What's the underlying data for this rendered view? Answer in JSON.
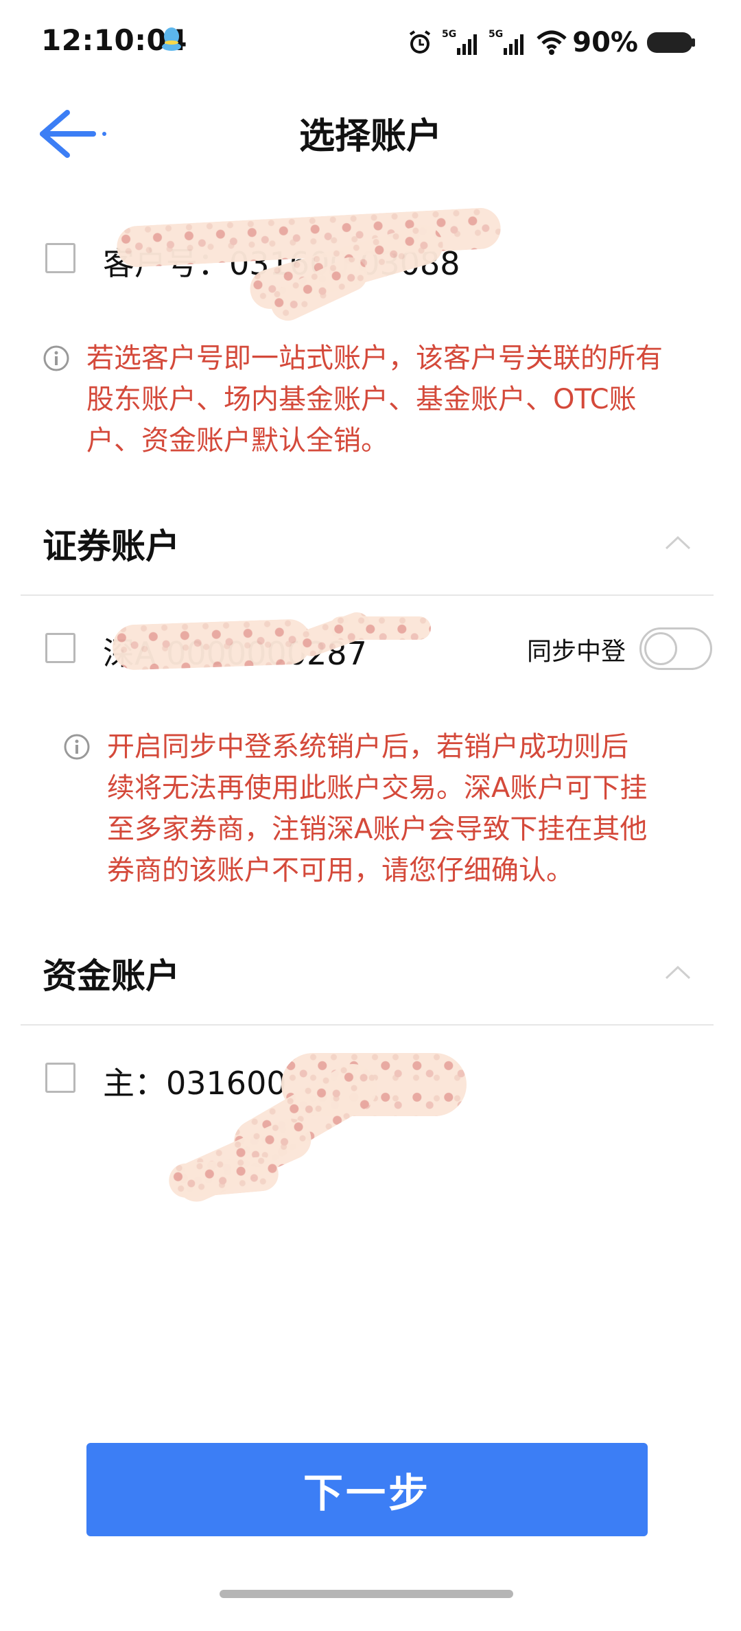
{
  "status_bar": {
    "time": "12:10:04",
    "battery": "90%",
    "icons": [
      "qq-icon",
      "alarm-icon",
      "signal-5g-icon",
      "signal-5g-icon",
      "wifi-icon",
      "battery-icon"
    ]
  },
  "header": {
    "title": "选择账户",
    "back_icon": "arrow-left-icon"
  },
  "customer_account": {
    "label": "客户号：031600 03088"
  },
  "customer_note": {
    "icon": "info-icon",
    "lines": [
      "若选客户号即一站式账户，该客户号关联的所有",
      "股东账户、场内基金账户、基金账户、OTC账",
      "户、资金账户默认全销。"
    ]
  },
  "securities_section": {
    "title": "证券账户",
    "chevron": "chevron-up-icon",
    "account_label": "深A 0000000287",
    "sync_label": "同步中登",
    "sync_enabled": false
  },
  "securities_note": {
    "icon": "info-icon",
    "lines": [
      "开启同步中登系统销户后，若销户成功则后",
      "续将无法再使用此账户交易。深A账户可下挂",
      "至多家券商，注销深A账户会导致下挂在其他",
      "券商的该账户不可用，请您仔细确认。"
    ]
  },
  "fund_section": {
    "title": "资金账户",
    "chevron": "chevron-up-icon",
    "account_label": "主：031600"
  },
  "next_button": {
    "label": "下一步"
  },
  "colors": {
    "primary": "#3c7ef5",
    "warning_text": "#d4493a",
    "divider": "#e6e6e6",
    "back_arrow": "#3c7ef5"
  }
}
